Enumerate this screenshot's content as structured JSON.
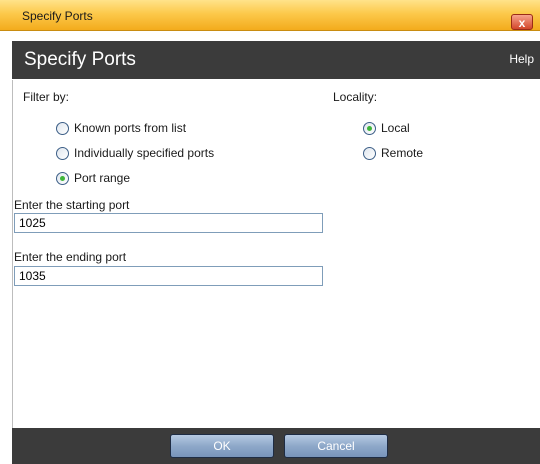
{
  "window": {
    "title": "Specify Ports",
    "close_glyph": "x"
  },
  "header": {
    "title": "Specify Ports",
    "help": "Help"
  },
  "filter": {
    "label": "Filter by:",
    "options": [
      {
        "label": "Known ports from list",
        "checked": false
      },
      {
        "label": "Individually specified ports",
        "checked": false
      },
      {
        "label": "Port range",
        "checked": true
      }
    ]
  },
  "locality": {
    "label": "Locality:",
    "options": [
      {
        "label": "Local",
        "checked": true
      },
      {
        "label": "Remote",
        "checked": false
      }
    ]
  },
  "starting_port": {
    "label": "Enter the starting port",
    "value": "1025"
  },
  "ending_port": {
    "label": "Enter the ending port",
    "value": "1035"
  },
  "footer": {
    "ok": "OK",
    "cancel": "Cancel"
  },
  "colors": {
    "titlebar": "#f3ab1c",
    "header": "#3b3b3b",
    "radio_checked": "#3fb53a",
    "button": "#8ea8c9"
  }
}
